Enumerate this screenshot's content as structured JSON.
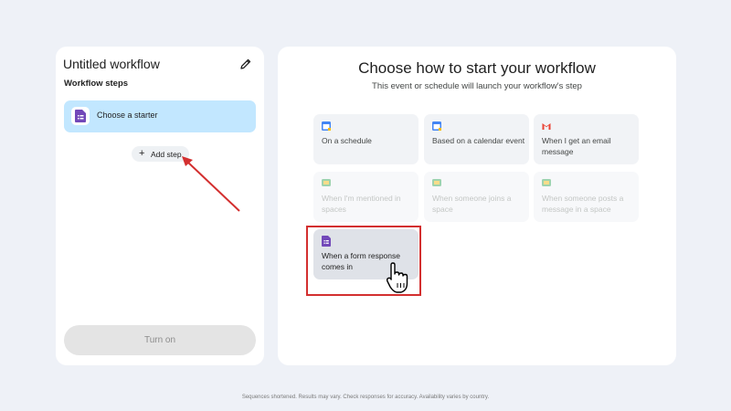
{
  "workflow": {
    "title": "Untitled workflow",
    "steps_label": "Workflow steps",
    "starter_label": "Choose a starter",
    "add_step_label": "Add step",
    "turn_on_label": "Turn on"
  },
  "main": {
    "title": "Choose how to start your workflow",
    "subtitle": "This event or schedule will launch your workflow's step"
  },
  "options": [
    {
      "label": "On a schedule",
      "icon": "calendar-icon",
      "state": "enabled"
    },
    {
      "label": "Based on a calendar event",
      "icon": "calendar-icon",
      "state": "enabled"
    },
    {
      "label": "When I get an email message",
      "icon": "gmail-icon",
      "state": "enabled"
    },
    {
      "label": "When I'm mentioned in spaces",
      "icon": "chat-icon",
      "state": "disabled"
    },
    {
      "label": "When someone joins a space",
      "icon": "chat-icon",
      "state": "disabled"
    },
    {
      "label": "When someone posts a message in a space",
      "icon": "chat-icon",
      "state": "disabled"
    },
    {
      "label": "When a form response comes in",
      "icon": "forms-icon",
      "state": "hovered"
    }
  ],
  "footer": "Sequences shortened. Results may vary. Check responses for accuracy. Availability varies by country.",
  "colors": {
    "starter_highlight": "#c2e7ff",
    "annotation_red": "#d32f2f",
    "forms_purple": "#7248b9"
  }
}
